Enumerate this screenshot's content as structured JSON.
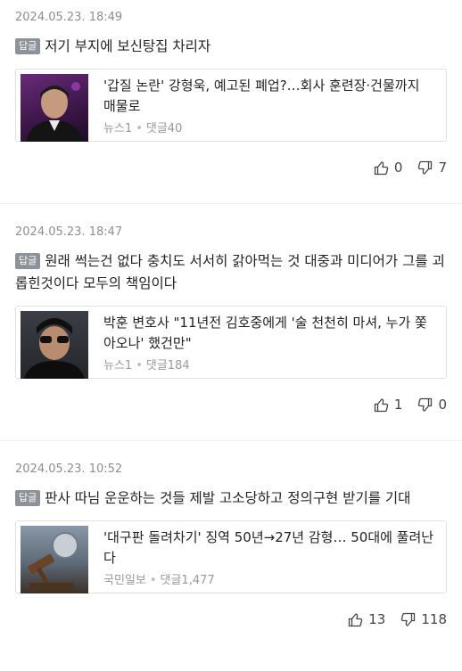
{
  "badge_label": "답글",
  "comments": [
    {
      "timestamp": "2024.05.23. 18:49",
      "text": "저기 부지에 보신탕집 차리자",
      "article": {
        "title": "'갑질 논란' 강형욱, 예고된 폐업?…회사 훈련장·건물까지 매물로",
        "source": "뉴스1",
        "comments": "댓글40"
      },
      "likes": "0",
      "dislikes": "7"
    },
    {
      "timestamp": "2024.05.23. 18:47",
      "text": "원래 썩는건 없다 충치도 서서히 갉아먹는 것 대중과 미디어가 그를 괴롭힌것이다 모두의 책임이다",
      "article": {
        "title": "박훈 변호사 \"11년전 김호중에게 '술 천천히 마셔, 누가 쫓아오나' 했건만\"",
        "source": "뉴스1",
        "comments": "댓글184"
      },
      "likes": "1",
      "dislikes": "0"
    },
    {
      "timestamp": "2024.05.23. 10:52",
      "text": "판사 따님 운운하는 것들 제발 고소당하고 정의구현 받기를 기대",
      "article": {
        "title": "'대구판 돌려차기' 징역 50년→27년 감형… 50대에 풀려난다",
        "source": "국민일보",
        "comments": "댓글1,477"
      },
      "likes": "13",
      "dislikes": "118"
    }
  ]
}
